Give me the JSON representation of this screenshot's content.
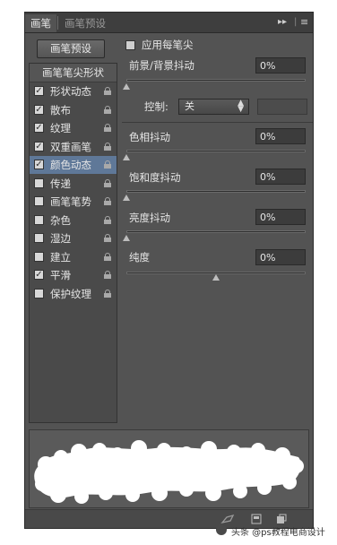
{
  "tabs": [
    {
      "label": "画笔",
      "active": true
    },
    {
      "label": "画笔预设",
      "active": false
    }
  ],
  "panel_menu_glyph": "▸▸ | ≡",
  "preset_button": "画笔预设",
  "brush_tip_shape_header": "画笔笔尖形状",
  "options": [
    {
      "label": "形状动态",
      "checked": true,
      "selected": false
    },
    {
      "label": "散布",
      "checked": true,
      "selected": false
    },
    {
      "label": "纹理",
      "checked": true,
      "selected": false
    },
    {
      "label": "双重画笔",
      "checked": true,
      "selected": false
    },
    {
      "label": "颜色动态",
      "checked": true,
      "selected": true
    },
    {
      "label": "传递",
      "checked": false,
      "selected": false
    },
    {
      "label": "画笔笔势",
      "checked": false,
      "selected": false
    },
    {
      "label": "杂色",
      "checked": false,
      "selected": false
    },
    {
      "label": "湿边",
      "checked": false,
      "selected": false
    },
    {
      "label": "建立",
      "checked": false,
      "selected": false
    },
    {
      "label": "平滑",
      "checked": true,
      "selected": false
    },
    {
      "label": "保护纹理",
      "checked": false,
      "selected": false
    }
  ],
  "apply_per_tip": {
    "label": "应用每笔尖",
    "checked": false
  },
  "fg_bg_jitter": {
    "label": "前景/背景抖动",
    "value": "0%",
    "level": 0
  },
  "control": {
    "label": "控制:",
    "value": "关"
  },
  "hue_jitter": {
    "label": "色相抖动",
    "value": "0%",
    "level": 0
  },
  "saturation_jitter": {
    "label": "饱和度抖动",
    "value": "0%",
    "level": 0
  },
  "brightness_jitter": {
    "label": "亮度抖动",
    "value": "0%",
    "level": 0
  },
  "purity": {
    "label": "纯度",
    "value": "0%",
    "level": 0.5
  },
  "watermark": "头条 @ps教程电商设计",
  "colors": {
    "panel": "#535353",
    "selected_row": "#5f7898",
    "preview_bg": "#5a5a5a",
    "stroke": "#ffffff"
  }
}
